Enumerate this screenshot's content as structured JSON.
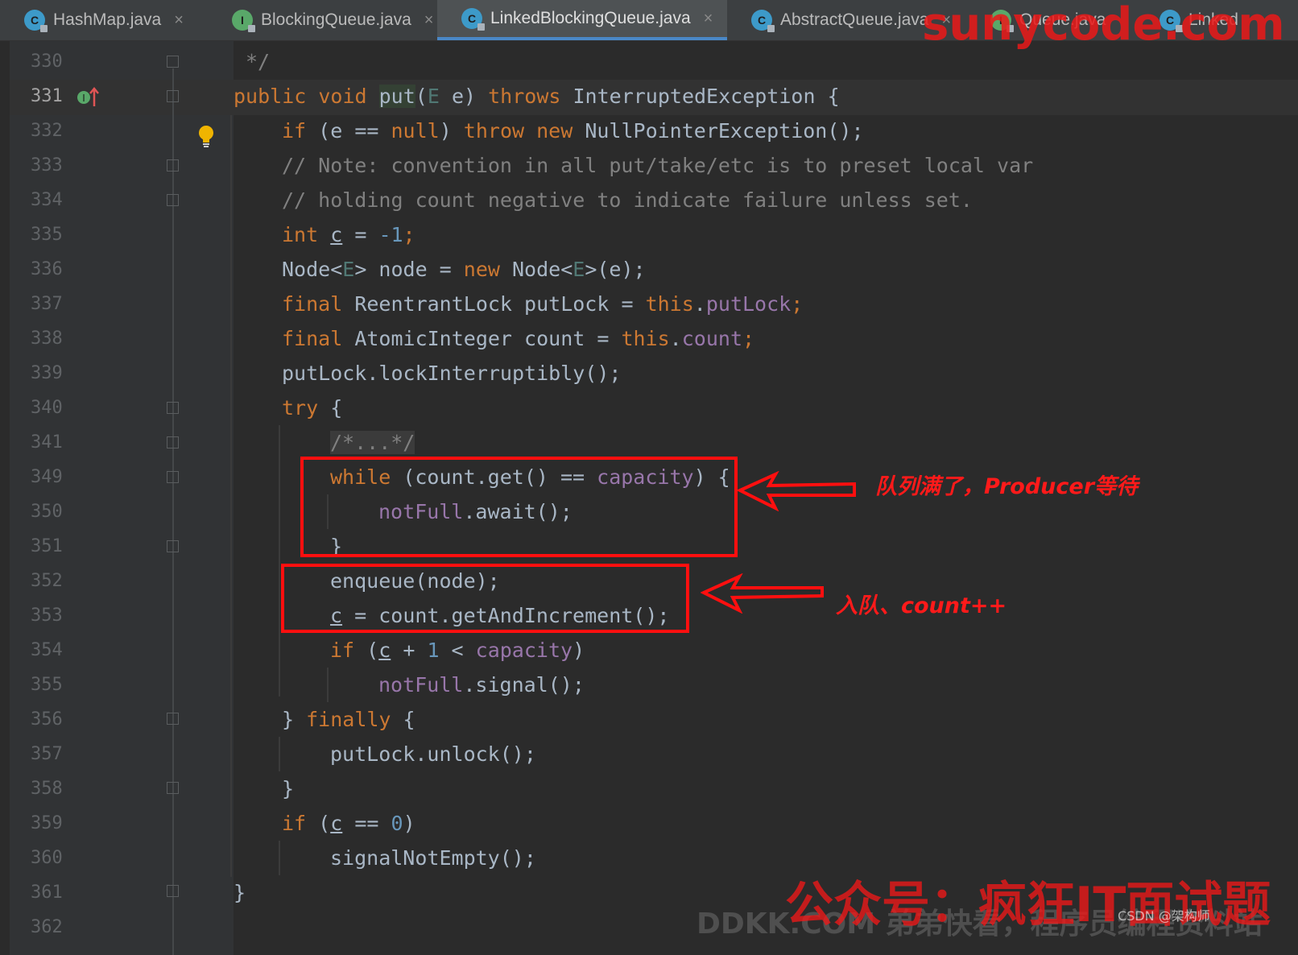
{
  "tabs": [
    {
      "label": "HashMap.java",
      "icon": "class-icon"
    },
    {
      "label": "BlockingQueue.java",
      "icon": "interface-icon"
    },
    {
      "label": "LinkedBlockingQueue.java",
      "icon": "class-icon",
      "active": true
    },
    {
      "label": "AbstractQueue.java",
      "icon": "abstract-class-icon"
    },
    {
      "label": "Queue.java",
      "icon": "interface-icon"
    },
    {
      "label": "Linked",
      "icon": "class-icon"
    }
  ],
  "tab_close_glyph": "×",
  "line_numbers": [
    "330",
    "331",
    "332",
    "333",
    "334",
    "335",
    "336",
    "337",
    "338",
    "339",
    "340",
    "341",
    "349",
    "350",
    "351",
    "352",
    "353",
    "354",
    "355",
    "356",
    "357",
    "358",
    "359",
    "360",
    "361",
    "362"
  ],
  "code": {
    "l330": "*/",
    "l331": [
      "public void ",
      "put",
      "(",
      "E",
      " e) ",
      "throws",
      " InterruptedException {"
    ],
    "l332": [
      "if",
      " (e == ",
      "null",
      ") ",
      "throw new",
      " NullPointerException();"
    ],
    "l333": "// Note: convention in all put/take/etc is to preset local var",
    "l334": "// holding count negative to indicate failure unless set.",
    "l335": [
      "int ",
      "c",
      " = ",
      "-1",
      ";"
    ],
    "l336": [
      "Node<",
      "E",
      "> node = ",
      "new",
      " Node<",
      "E",
      ">(e);"
    ],
    "l337": [
      "final",
      " ReentrantLock putLock = ",
      "this",
      ".",
      "putLock",
      ";"
    ],
    "l338": [
      "final",
      " AtomicInteger count = ",
      "this",
      ".",
      "count",
      ";"
    ],
    "l339": "putLock.lockInterruptibly();",
    "l340": [
      "try",
      " {"
    ],
    "l341": "/*...*/",
    "l349": [
      "while",
      " (count.get() == ",
      "capacity",
      ") {"
    ],
    "l350": [
      "notFull",
      ".await();"
    ],
    "l351": "}",
    "l352": "enqueue(node);",
    "l353": [
      "c",
      " = count.getAndIncrement();"
    ],
    "l354": [
      "if",
      " (",
      "c",
      " + ",
      "1",
      " < ",
      "capacity",
      ")"
    ],
    "l355": [
      "notFull",
      ".signal();"
    ],
    "l356": [
      "} ",
      "finally",
      " {"
    ],
    "l357": "putLock.unlock();",
    "l358": "}",
    "l359": [
      "if",
      " (",
      "c",
      " == ",
      "0",
      ")"
    ],
    "l360": "signalNotEmpty();",
    "l361": "}"
  },
  "annotations": {
    "note_wait": "队列满了，Producer等待",
    "note_enqueue": "入队、count++"
  },
  "watermarks": {
    "top": "sunycode.com",
    "bottom_red": "公众号：疯狂IT面试题",
    "bottom_gray": "DDKK.COM 弟弟快看，程序员编程资料站",
    "csdn": "CSDN @架构师"
  },
  "colors": {
    "keyword": "#cc7832",
    "annotation_red": "#ff0f0f",
    "tab_underline": "#4a88c7"
  }
}
